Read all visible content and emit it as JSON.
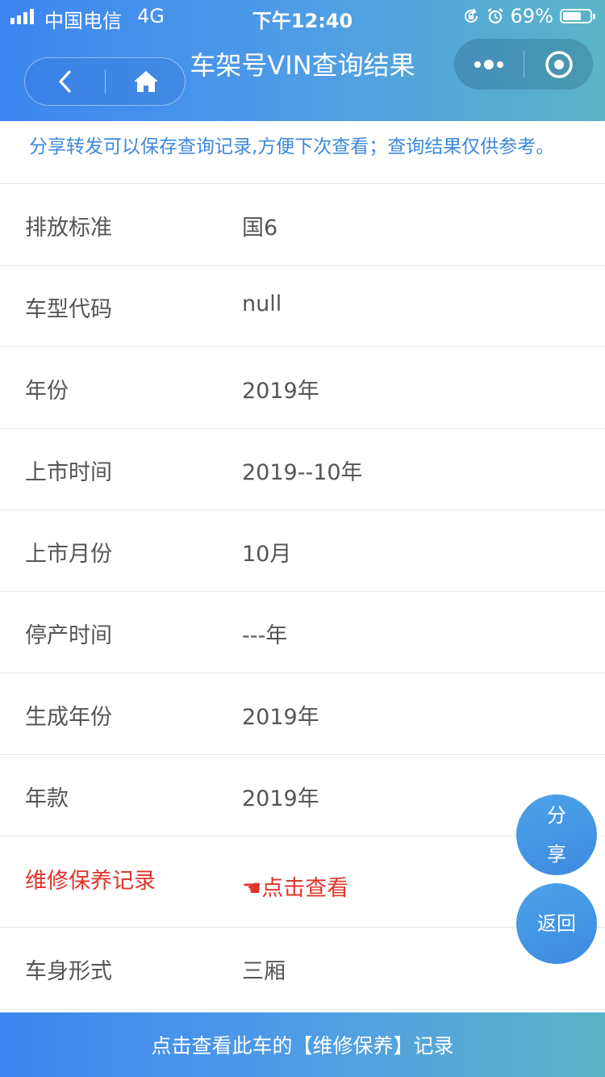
{
  "status_bar": {
    "carrier": "中国电信",
    "network": "4G",
    "time": "下午12:40",
    "battery_percent": "69%",
    "battery_level": 0.69,
    "icons": [
      "signal-icon",
      "rotation-lock-icon",
      "alarm-icon",
      "battery-icon"
    ]
  },
  "nav": {
    "title": "车架号VIN查询结果",
    "back_icon": "chevron-left-icon",
    "home_icon": "home-icon",
    "more_icon": "more-dots-icon",
    "close_icon": "target-circle-icon"
  },
  "notice": "分享转发可以保存查询记录,方便下次查看；查询结果仅供参考。",
  "rows": [
    {
      "label": "排放标准",
      "value": "国6"
    },
    {
      "label": "车型代码",
      "value": "null"
    },
    {
      "label": "年份",
      "value": "2019年"
    },
    {
      "label": "上市时间",
      "value": "2019--10年"
    },
    {
      "label": "上市月份",
      "value": "10月"
    },
    {
      "label": "停产时间",
      "value": "---年"
    },
    {
      "label": "生成年份",
      "value": "2019年"
    },
    {
      "label": "年款",
      "value": "2019年"
    },
    {
      "label": "维修保养记录",
      "value": "☚点击查看"
    },
    {
      "label": "车身形式",
      "value": "三厢"
    }
  ],
  "float_buttons": {
    "share": "分享",
    "back": "返回"
  },
  "bottom_button": "点击查看此车的【维修保养】记录",
  "colors": {
    "header_gradient_start": "#3d85f0",
    "header_gradient_end": "#5bb5c7",
    "notice_text": "#3d88da",
    "highlight_red": "#e0342b",
    "row_text": "#555555"
  }
}
